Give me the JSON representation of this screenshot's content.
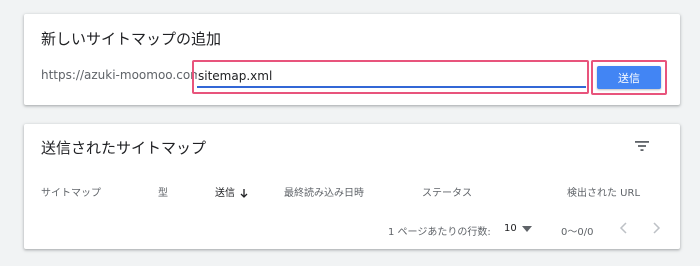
{
  "add_sitemap": {
    "title": "新しいサイトマップの追加",
    "url_prefix": "https://azuki-moomoo.com/",
    "input_value": "sitemap.xml",
    "submit_label": "送信"
  },
  "submitted": {
    "title": "送信されたサイトマップ",
    "columns": [
      "サイトマップ",
      "型",
      "送信",
      "最終読み込み日時",
      "ステータス",
      "検出された URL"
    ],
    "sort_icon": "arrow-down-icon",
    "filter_icon": "filter-icon",
    "pagination": {
      "rows_per_page_label": "1 ページあたりの行数:",
      "rows_per_page_value": "10",
      "range": "0～0/0"
    }
  },
  "colors": {
    "accent": "#4285f4",
    "highlight": "#e8547c",
    "background": "#f1f3f4"
  }
}
